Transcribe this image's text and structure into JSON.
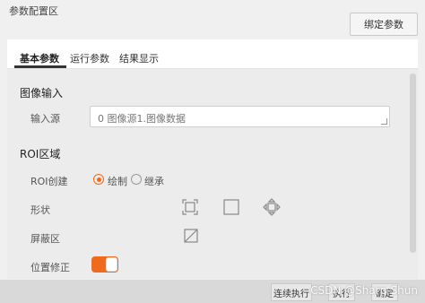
{
  "header": {
    "title": "参数配置区",
    "bind_button": "绑定参数"
  },
  "tabs": [
    {
      "label": "基本参数",
      "active": true
    },
    {
      "label": "运行参数",
      "active": false
    },
    {
      "label": "结果显示",
      "active": false
    }
  ],
  "image_input": {
    "section_title": "图像输入",
    "source_label": "输入源",
    "source_value": "0 图像源1.图像数据"
  },
  "roi": {
    "section_title": "ROI区域",
    "create_label": "ROI创建",
    "options": [
      {
        "label": "绘制",
        "selected": true
      },
      {
        "label": "继承",
        "selected": false
      }
    ],
    "shape_label": "形状",
    "shape_icons": [
      "select-box-icon",
      "rectangle-icon",
      "move-arrows-icon"
    ],
    "mask_label": "屏蔽区",
    "mask_icon": "eraser-icon",
    "position_label": "位置修正",
    "position_enabled": true
  },
  "footer": {
    "run_button": "连续执行",
    "exec_button": "执行",
    "ok_button": "确定"
  },
  "watermark": "CSDN @Sharp-Shun",
  "colors": {
    "accent": "#f06a1d"
  }
}
